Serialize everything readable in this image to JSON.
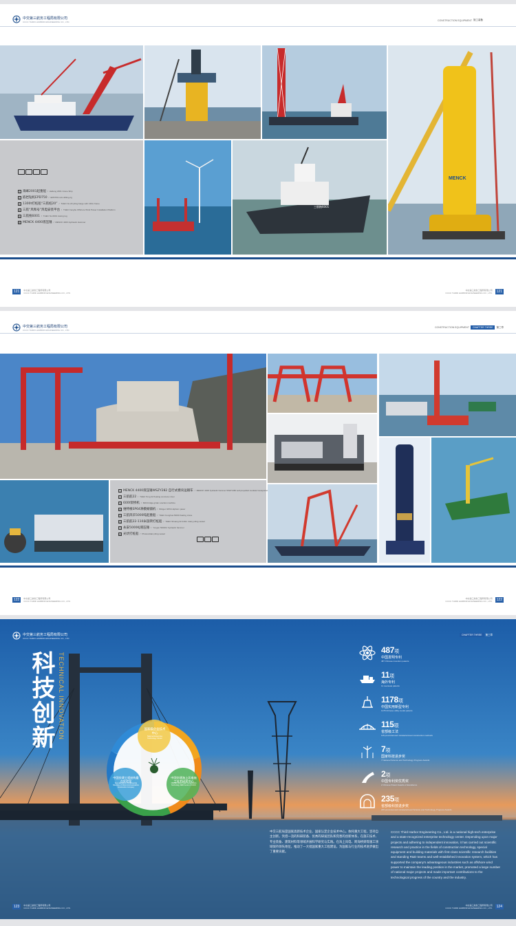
{
  "brand": {
    "name_cn": "中交第三航务工程局有限公司",
    "name_en": "CCCC THIRD HARBOR ENGINEERING CO., LTD."
  },
  "chapter": {
    "en_1": "CONSTRUCTION EQUIPMENT",
    "cn_1": "施工装备",
    "tag": "CHAPTER THREE",
    "cn_3": "第三章"
  },
  "colors": {
    "brand_blue": "#1b4d8c",
    "accent_gold": "#e8b64a",
    "legend_gray": "#c8c9cc"
  },
  "page1": {
    "legend": [
      {
        "num": "1",
        "cn": "海峰2001起重船",
        "en": "Haifeng 2001 Crane Ship"
      },
      {
        "num": "2",
        "cn": "嵌岩钻机EPD750",
        "en": "EPD750 rock drilling rig"
      },
      {
        "num": "3",
        "cn": "1300t打桩船“三航桩20”",
        "en": "THEC No.20 piling barge with 130m frame"
      },
      {
        "num": "4",
        "cn": "三航“风和号”风电安装平台",
        "en": "THEC Fenghe Offshore Wind Power Installation Platform"
      },
      {
        "num": "5",
        "cn": "三航拖6001",
        "en": "THEC No.6001 towing tug"
      },
      {
        "num": "6",
        "cn": "MENCK 4400液压锤",
        "en": "MENCK 4400 Hydraulic Hammer"
      }
    ],
    "ship_name": "三航拖6001",
    "hammer_brand": "MENCK"
  },
  "page2": {
    "legend": [
      {
        "num": "1",
        "cn": "MENCK 4400液压锤WSZY282 自行式模块运输车",
        "en": "MENCK 4400 hydraulic hammer WSZY282 self-propelled modular transportation vehicle"
      },
      {
        "num": "2",
        "cn": "三航航22",
        "en": "THEC Tong 22 floating concrete mixer"
      },
      {
        "num": "3",
        "cn": "600t架桥机",
        "en": "600t bridge girder erection machine"
      },
      {
        "num": "4",
        "cn": "维特根SP64滑模摊铺机",
        "en": "Wirtgen SP64 slipform paver"
      },
      {
        "num": "5",
        "cn": "三航风华5000吨起重船",
        "en": "THEC Fenghua 5000t floating crane"
      },
      {
        "num": "6",
        "cn": "三航航22-110米旋转打桩船",
        "en": "THEC Shuang 22-110m rotary piling vessel"
      },
      {
        "num": "7",
        "cn": "永安5000KJ液压锤",
        "en": "Yongan 5000KJ hydraulic hammer"
      },
      {
        "num": "8",
        "cn": "光伏打桩船",
        "en": "Photovoltaic piling vessel"
      }
    ]
  },
  "page3": {
    "title_cn": "科技创新",
    "title_cn_line1": "科技",
    "title_cn_line2": "创新",
    "title_en": "TECHNICAL INNOVATION",
    "circle_top_cn": "国家级企业技术中心",
    "circle_top_en": "National Enterprise Technology Center",
    "circle_left_cn": "中国交建工程结构重点实验室",
    "circle_left_en": "Key Laboratory of Engineering Structure of China Communications Construction Company",
    "circle_right_cn": "中国交建海上风电施工技术研发中心",
    "circle_right_en": "Offshore Wind Power Construction Technology R&D Center of CCCC",
    "stats": [
      {
        "icon": "atom-icon",
        "num": "487",
        "unit": "项",
        "cn": "中国发明专利",
        "en": "487 Chinese invention patents"
      },
      {
        "icon": "ship-icon",
        "num": "11",
        "unit": "项",
        "cn": "海外专利",
        "en": "11 overseas patents"
      },
      {
        "icon": "offshore-platform-icon",
        "num": "1178",
        "unit": "项",
        "cn": "中国实用新型专利",
        "en": "1178 Chinese utility model patents"
      },
      {
        "icon": "bridge-icon",
        "num": "115",
        "unit": "项",
        "cn": "省部级工法",
        "en": "115 provincial and ministerial level construction methods"
      },
      {
        "icon": "wind-turbine-icon",
        "num": "7",
        "unit": "项",
        "cn": "国家科技进步奖",
        "en": "7 National Science and Technology Progress Awards"
      },
      {
        "icon": "road-icon",
        "num": "2",
        "unit": "项",
        "cn": "中国专利奖优秀奖",
        "en": "2 Chinese Patent Awards of Excellence"
      },
      {
        "icon": "tunnel-icon",
        "num": "235",
        "unit": "项",
        "cn": "省部级科技进步奖",
        "en": "235 provincial and ministerial level Science and Technology Progress Awards"
      }
    ],
    "para_cn": "中交三航局是国家高新技术企业、国家认定企业技术中心。依托重大工程，坚持自主创新，凭借一流的科研装备、优秀的研发团队和完善的创新体系，在施工技术、专业装备、建筑材料等领域开展科学研究与实践。在海上风电、跨海桥梁等施工领域保持领先地位，推动了一大批国家重大工程建设，为国家与行业的技术进步做出了重要贡献。",
    "para_en": "CCCC Third Harbor Engineering Co., Ltd. is a national high-tech enterprise and a state-recognized enterprise technology center. Depending upon major projects and adhering to independent innovation, it has carried out scientific research and practice in the fields of construction technology, special equipment and building materials with first-class scientific research facilities and standing R&D teams and well-established innovation system, which has supported the company's advantageous industries such as offshore wind power to maintain the leading position in the market, promoted a large number of national major projects and made important contributions to the technological progress of the country and the industry."
  },
  "pages": {
    "p1": "121",
    "p2": "122",
    "p3_left": "123",
    "p3_right": "124"
  }
}
